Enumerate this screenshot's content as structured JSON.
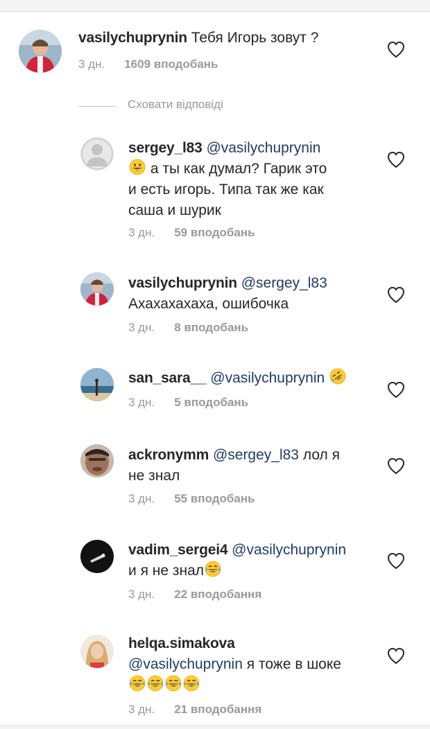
{
  "comments": [
    {
      "username": "vasilychuprynin",
      "mention": "",
      "text": "Тебя Игорь зовут ?",
      "time": "3 дн.",
      "likes": "1609 вподобань",
      "emoji": ""
    },
    {
      "username": "sergey_l83",
      "mention": "@vasilychuprynin",
      "text": "а ты как думал? Гарик это",
      "text2": "и есть игорь. Типа так же как",
      "text3": "саша и шурик",
      "time": "3 дн.",
      "likes": "59 вподобань",
      "emoji": "grinning-emoji"
    },
    {
      "username": "vasilychuprynin",
      "mention": "@sergey_l83",
      "text": "Ахахахахаха, ошибочка",
      "time": "3 дн.",
      "likes": "8 вподобань",
      "emoji": ""
    },
    {
      "username": "san_sara__",
      "mention": "@vasilychuprynin",
      "text": "",
      "time": "3 дн.",
      "likes": "5 вподобань",
      "emoji": "rofl-emoji"
    },
    {
      "username": "ackronymm",
      "mention": "@sergey_l83",
      "text": "лол я",
      "text2": "не знал",
      "time": "3 дн.",
      "likes": "55 вподобань",
      "emoji": ""
    },
    {
      "username": "vadim_sergei4",
      "mention": "@vasilychuprynin",
      "text": "и я не знал",
      "time": "3 дн.",
      "likes": "22 вподобання",
      "emoji": "tears-of-joy-emoji"
    },
    {
      "username": "helqa.simakova",
      "mention": "@vasilychuprynin",
      "text": "я тоже в шоке",
      "time": "3 дн.",
      "likes": "21 вподобання",
      "emoji": "tears-of-joy-emoji"
    }
  ],
  "hide_replies_label": "Сховати відповіді",
  "colors": {
    "mention": "#1d3b5e",
    "meta": "#999999",
    "heart": "#262626"
  }
}
